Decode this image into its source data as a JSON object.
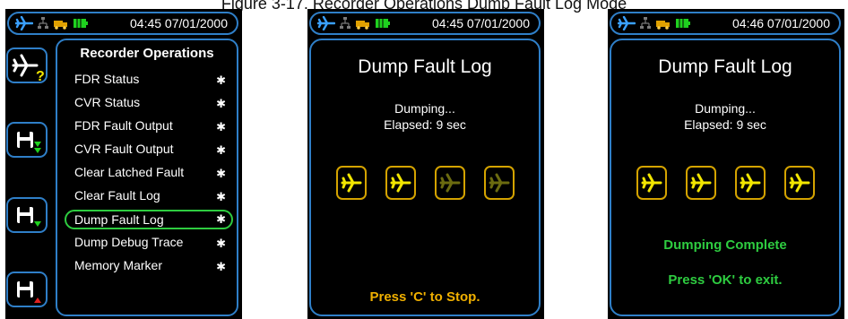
{
  "caption": "Figure 3-17. Recorder Operations Dump Fault Log Mode",
  "colors": {
    "frame_blue": "#2f7fc8",
    "selection_green": "#2ecc40",
    "plane_yellow": "#f2e600",
    "plane_dim": "#6b6b10",
    "stop_text": "#f0b000",
    "complete_text": "#2ecc40"
  },
  "screens": [
    {
      "status": {
        "time": "04:45 07/01/2000",
        "icons": [
          "airplane-icon",
          "network-icon",
          "truck-icon",
          "battery-icon"
        ]
      },
      "side_buttons": [
        {
          "icon": "airplane-help-icon"
        },
        {
          "icon": "floppy-down-green-icon"
        },
        {
          "icon": "floppy-down-small-green-icon"
        },
        {
          "icon": "floppy-up-red-icon"
        }
      ],
      "menu": {
        "title": "Recorder Operations",
        "items": [
          {
            "label": "FDR Status",
            "icon": "gear-icon"
          },
          {
            "label": "CVR Status",
            "icon": "gear-icon"
          },
          {
            "label": "FDR Fault Output",
            "icon": "gear-icon"
          },
          {
            "label": "CVR Fault Output",
            "icon": "gear-icon"
          },
          {
            "label": "Clear Latched Fault",
            "icon": "gear-icon"
          },
          {
            "label": "Clear Fault Log",
            "icon": "gear-icon"
          },
          {
            "label": "Dump Fault Log",
            "icon": "gear-icon",
            "selected": true
          },
          {
            "label": "Dump Debug Trace",
            "icon": "gear-icon"
          },
          {
            "label": "Memory Marker",
            "icon": "gear-icon"
          }
        ]
      }
    },
    {
      "status": {
        "time": "04:45 07/01/2000"
      },
      "title": "Dump Fault Log",
      "status_line": "Dumping...",
      "elapsed": "Elapsed: 9 sec",
      "progress": {
        "completed_steps": 2,
        "total_steps": 4
      },
      "footer": "Press 'C' to Stop."
    },
    {
      "status": {
        "time": "04:46 07/01/2000"
      },
      "title": "Dump Fault Log",
      "status_line": "Dumping...",
      "elapsed": "Elapsed: 9 sec",
      "progress": {
        "completed_steps": 4,
        "total_steps": 4
      },
      "complete": "Dumping Complete",
      "footer": "Press 'OK' to exit."
    }
  ]
}
